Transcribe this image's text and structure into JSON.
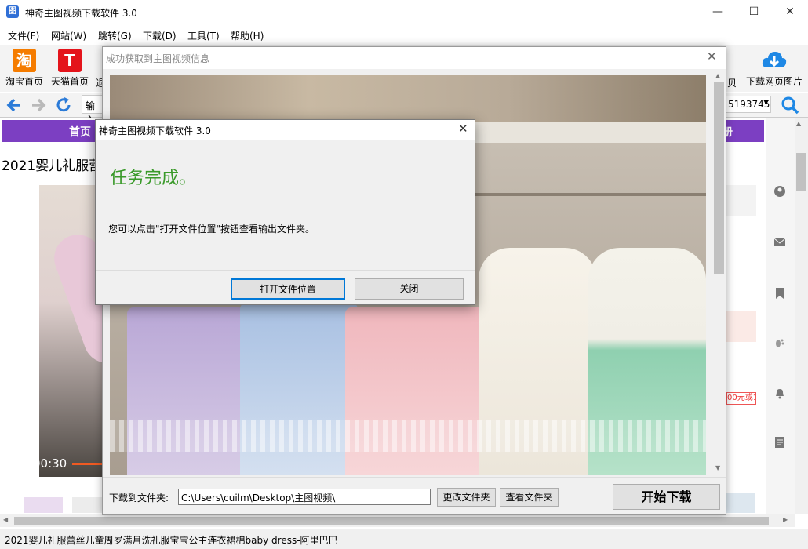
{
  "window": {
    "title": "神奇主图视频下载软件 3.0",
    "icon_text": "图",
    "controls": [
      "—",
      "☐",
      "✕"
    ]
  },
  "menu": [
    "文件(F)",
    "网站(W)",
    "跳转(G)",
    "下载(D)",
    "工具(T)",
    "帮助(H)"
  ],
  "toolbar": {
    "taobao": {
      "icon": "淘",
      "label": "淘宝首页",
      "color": "#f57c00"
    },
    "tmall": {
      "icon": "T",
      "label": "天猫首页",
      "color": "#e4141b"
    },
    "partial_left": "退",
    "partial_right": "贝",
    "download_images": {
      "label": "下载网页图片",
      "color": "#1e88e5"
    }
  },
  "navbar": {
    "address_partial": "输入",
    "number_partial": "5193745"
  },
  "webpage": {
    "nav_home": "首页",
    "nav_right_partial": "册",
    "product_title_partial": "2021婴儿礼服蕾",
    "video_time": "00:30",
    "price_badge_partial": "00元或1",
    "accent_color": "#7c3fc2"
  },
  "statusbar": {
    "text": "2021婴儿礼服蕾丝儿童周岁满月洗礼服宝宝公主连衣裙棉baby dress-阿里巴巴"
  },
  "preview": {
    "title": "成功获取到主图视频信息",
    "folder_label": "下载到文件夹:",
    "folder_path": "C:\\Users\\cuilm\\Desktop\\主图视频\\",
    "change_folder": "更改文件夹",
    "view_folder": "查看文件夹",
    "start_download": "开始下载"
  },
  "dialog": {
    "title": "神奇主图视频下载软件 3.0",
    "heading": "任务完成。",
    "message": "您可以点击\"打开文件位置\"按钮查看输出文件夹。",
    "open_location": "打开文件位置",
    "close": "关闭",
    "heading_color": "#3a9a2a"
  }
}
